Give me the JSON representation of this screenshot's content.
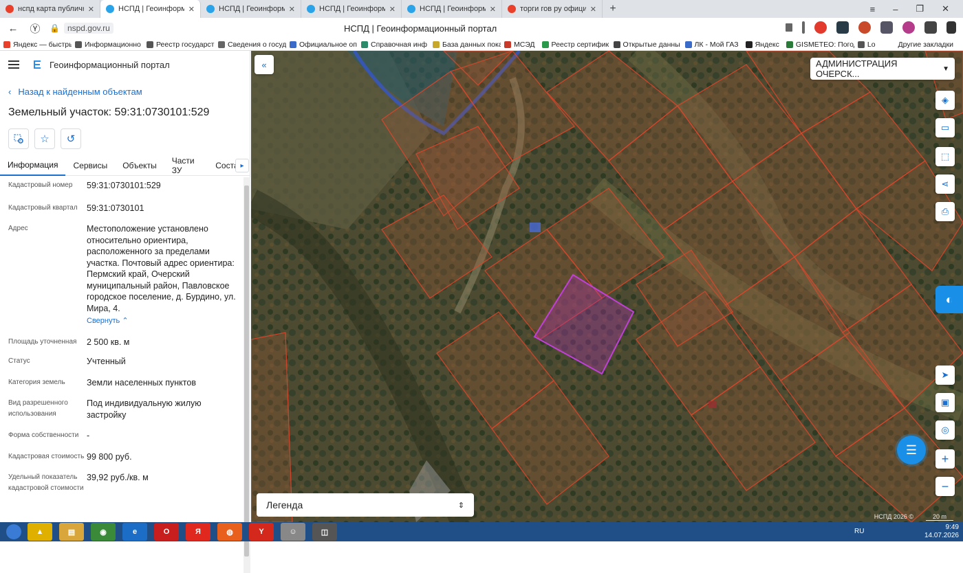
{
  "browser": {
    "tabs": [
      {
        "label": "нспд карта публичная кад",
        "color": "#e8402a",
        "active": false
      },
      {
        "label": "НСПД | Геоинформацио",
        "color": "#2aa3e8",
        "active": true
      },
      {
        "label": "НСПД | Геоинформацио",
        "color": "#2aa3e8",
        "active": false
      },
      {
        "label": "НСПД | Геоинформацио",
        "color": "#2aa3e8",
        "active": false
      },
      {
        "label": "НСПД | Геоинформацио",
        "color": "#2aa3e8",
        "active": false
      },
      {
        "label": "торги гов ру официальн",
        "color": "#e8402a",
        "active": false
      }
    ],
    "new_tab": "+",
    "url": "nspd.gov.ru",
    "page_title": "НСПД | Геоинформационный портал",
    "bookmarks": [
      "Яндекс — быстрый",
      "Информационно",
      "Реестр государст",
      "Сведения о госуд",
      "Официальное оп",
      "Справочная инф",
      "База данных пока",
      "МСЭД",
      "Реестр сертифик",
      "Открытые данны",
      "ЛК - Мой ГАЗ",
      "Яндекс",
      "GISMETEO: Погод",
      "Lo"
    ],
    "other_bookmarks": "Другие закладки"
  },
  "sidebar": {
    "app_title": "Геоинформационный портал",
    "back_link": "Назад к найденным объектам",
    "object_title": "Земельный участок: 59:31:0730101:529",
    "tabs": [
      "Информация",
      "Сервисы",
      "Объекты",
      "Части ЗУ",
      "Состав"
    ],
    "props": [
      {
        "k": "Кадастровый номер",
        "v": "59:31:0730101:529"
      },
      {
        "k": "Кадастровый квартал",
        "v": "59:31:0730101"
      },
      {
        "k": "Адрес",
        "v": "Местоположение установлено относительно ориентира, расположенного за пределами участка. Почтовый адрес ориентира: Пермский край, Очерский муниципальный район, Павловское городское поселение, д. Бурдино, ул. Мира, 4."
      },
      {
        "k": "Площадь уточненная",
        "v": "2 500 кв. м"
      },
      {
        "k": "Статус",
        "v": "Учтенный"
      },
      {
        "k": "Категория земель",
        "v": "Земли населенных пунктов"
      },
      {
        "k": "Вид разрешенного использования",
        "v": "Под индивидуальную жилую застройку"
      },
      {
        "k": "Форма собственности",
        "v": "-"
      },
      {
        "k": "Кадастровая стоимость",
        "v": "99 800 руб."
      },
      {
        "k": "Удельный показатель кадастровой стоимости",
        "v": "39,92 руб./кв. м"
      }
    ],
    "collapse_label": "Свернуть"
  },
  "map": {
    "admin_select": "АДМИНИСТРАЦИЯ ОЧЕРСК...",
    "legend": "Легенда",
    "copyright": "НСПД 2026 ©",
    "scale": "20 m"
  },
  "taskbar": {
    "lang": "RU",
    "time": "9:49",
    "date": "14.07.2026"
  }
}
